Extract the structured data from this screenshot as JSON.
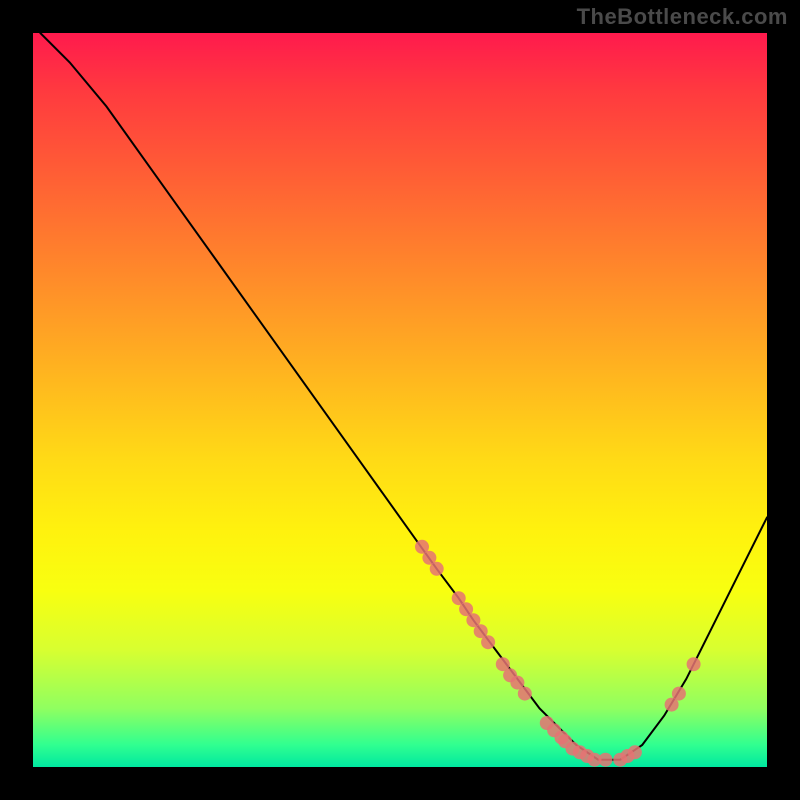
{
  "watermark": "TheBottleneck.com",
  "chart_data": {
    "type": "line",
    "title": "",
    "xlabel": "",
    "ylabel": "",
    "xlim": [
      0,
      100
    ],
    "ylim": [
      0,
      100
    ],
    "grid": false,
    "legend": false,
    "background_gradient": {
      "from": "#ff1a4d",
      "to": "#00e8a0",
      "direction": "top-to-bottom"
    },
    "series": [
      {
        "name": "bottleneck-curve",
        "color": "#000000",
        "x": [
          1,
          5,
          10,
          15,
          20,
          25,
          30,
          35,
          40,
          45,
          50,
          55,
          58,
          60,
          63,
          66,
          69,
          72,
          74,
          77,
          80,
          83,
          86,
          89,
          92,
          96,
          100
        ],
        "y": [
          100,
          96,
          90,
          83,
          76,
          69,
          62,
          55,
          48,
          41,
          34,
          27,
          23,
          20,
          16,
          12,
          8,
          5,
          3,
          1,
          1,
          3,
          7,
          12,
          18,
          26,
          34
        ]
      }
    ],
    "scatter_points": {
      "name": "sample-dots",
      "color": "#e57373",
      "radius": 1.0,
      "points": [
        {
          "x": 53,
          "y": 30
        },
        {
          "x": 54,
          "y": 28.5
        },
        {
          "x": 55,
          "y": 27
        },
        {
          "x": 58,
          "y": 23
        },
        {
          "x": 59,
          "y": 21.5
        },
        {
          "x": 60,
          "y": 20
        },
        {
          "x": 61,
          "y": 18.5
        },
        {
          "x": 62,
          "y": 17
        },
        {
          "x": 64,
          "y": 14
        },
        {
          "x": 65,
          "y": 12.5
        },
        {
          "x": 66,
          "y": 11.5
        },
        {
          "x": 67,
          "y": 10
        },
        {
          "x": 70,
          "y": 6
        },
        {
          "x": 71,
          "y": 5
        },
        {
          "x": 72,
          "y": 4
        },
        {
          "x": 72.5,
          "y": 3.5
        },
        {
          "x": 73.5,
          "y": 2.5
        },
        {
          "x": 74.5,
          "y": 2
        },
        {
          "x": 75.5,
          "y": 1.5
        },
        {
          "x": 76.5,
          "y": 1
        },
        {
          "x": 78,
          "y": 1
        },
        {
          "x": 80,
          "y": 1
        },
        {
          "x": 81,
          "y": 1.5
        },
        {
          "x": 82,
          "y": 2
        },
        {
          "x": 87,
          "y": 8.5
        },
        {
          "x": 88,
          "y": 10
        },
        {
          "x": 90,
          "y": 14
        }
      ]
    }
  }
}
